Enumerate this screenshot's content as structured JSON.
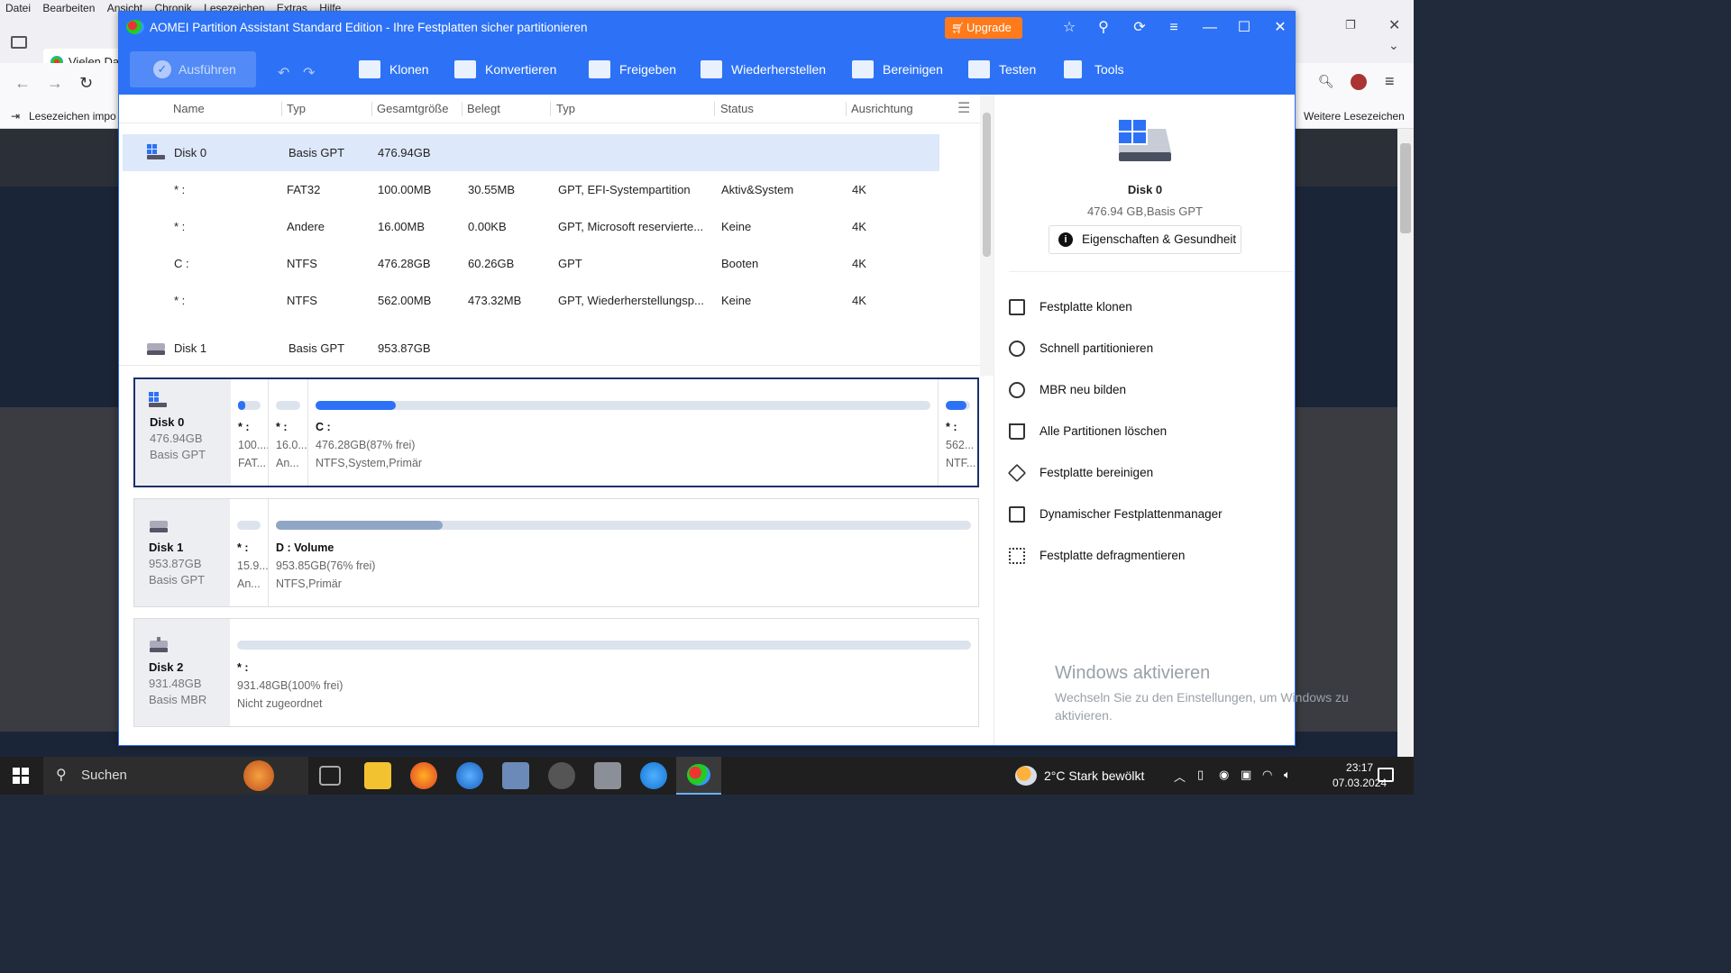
{
  "browser": {
    "menu": [
      "Datei",
      "Bearbeiten",
      "Ansicht",
      "Chronik",
      "Lesezeichen",
      "Extras",
      "Hilfe"
    ],
    "tab_label": "Vielen Da",
    "bookmark_import": "Lesezeichen impo",
    "bookmark_more": "Weitere Lesezeichen"
  },
  "app": {
    "title": "AOMEI Partition Assistant Standard Edition - Ihre Festplatten sicher partitionieren",
    "upgrade": "Upgrade",
    "run": "Ausführen",
    "tools": [
      "Klonen",
      "Konvertieren",
      "Freigeben",
      "Wiederherstellen",
      "Bereinigen",
      "Testen",
      "Tools"
    ]
  },
  "table": {
    "headers": [
      "Name",
      "Typ",
      "Gesamtgröße",
      "Belegt",
      "Typ",
      "Status",
      "Ausrichtung"
    ],
    "rows": [
      {
        "name": "Disk 0",
        "typ": "Basis GPT",
        "size": "476.94GB",
        "used": "",
        "ptype": "",
        "status": "",
        "align": ""
      },
      {
        "name": "* :",
        "typ": "FAT32",
        "size": "100.00MB",
        "used": "30.55MB",
        "ptype": "GPT, EFI-Systempartition",
        "status": "Aktiv&System",
        "align": "4K"
      },
      {
        "name": "* :",
        "typ": "Andere",
        "size": "16.00MB",
        "used": "0.00KB",
        "ptype": "GPT, Microsoft reservierte...",
        "status": "Keine",
        "align": "4K"
      },
      {
        "name": "C :",
        "typ": "NTFS",
        "size": "476.28GB",
        "used": "60.26GB",
        "ptype": "GPT",
        "status": "Booten",
        "align": "4K"
      },
      {
        "name": "* :",
        "typ": "NTFS",
        "size": "562.00MB",
        "used": "473.32MB",
        "ptype": "GPT, Wiederherstellungsp...",
        "status": "Keine",
        "align": "4K"
      },
      {
        "name": "Disk 1",
        "typ": "Basis GPT",
        "size": "953.87GB",
        "used": "",
        "ptype": "",
        "status": "",
        "align": ""
      }
    ]
  },
  "disks": [
    {
      "name": "Disk 0",
      "size": "476.94GB",
      "type": "Basis GPT",
      "parts": [
        {
          "name": "* :",
          "size": "100....",
          "fs": "FAT...",
          "fill": 0.31
        },
        {
          "name": "* :",
          "size": "16.0...",
          "fs": "An...",
          "fill": 0.0
        },
        {
          "name": "C :",
          "size": "476.28GB(87% frei)",
          "fs": "NTFS,System,Primär",
          "fill": 0.13
        },
        {
          "name": "* :",
          "size": "562...",
          "fs": "NTF...",
          "fill": 0.84
        }
      ]
    },
    {
      "name": "Disk 1",
      "size": "953.87GB",
      "type": "Basis GPT",
      "parts": [
        {
          "name": "* :",
          "size": "15.9...",
          "fs": "An...",
          "fill": 0.0
        },
        {
          "name": "D : Volume",
          "size": "953.85GB(76% frei)",
          "fs": "NTFS,Primär",
          "fill": 0.24
        }
      ]
    },
    {
      "name": "Disk 2",
      "size": "931.48GB",
      "type": "Basis MBR",
      "parts": [
        {
          "name": "* :",
          "size": "931.48GB(100% frei)",
          "fs": "Nicht zugeordnet",
          "fill": 0.0
        }
      ]
    }
  ],
  "right_panel": {
    "disk_name": "Disk 0",
    "disk_sub": "476.94 GB,Basis GPT",
    "props_button": "Eigenschaften & Gesundheit",
    "ops": [
      "Festplatte klonen",
      "Schnell partitionieren",
      "MBR neu bilden",
      "Alle Partitionen löschen",
      "Festplatte bereinigen",
      "Dynamischer Festplattenmanager",
      "Festplatte defragmentieren"
    ]
  },
  "watermark": {
    "title": "Windows aktivieren",
    "sub": "Wechseln Sie zu den Einstellungen, um Windows zu aktivieren."
  },
  "taskbar": {
    "search": "Suchen",
    "weather": "2°C  Stark bewölkt",
    "time": "23:17",
    "date": "07.03.2024"
  },
  "colors": {
    "accent": "#2d72f6",
    "upgrade": "#ff7a1a",
    "selected_row": "#dde8fa",
    "active_border": "#1d2f6b"
  }
}
